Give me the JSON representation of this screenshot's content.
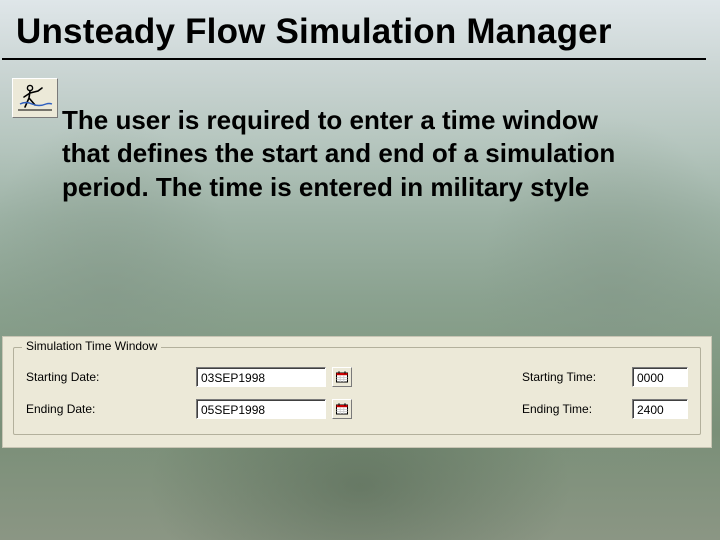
{
  "title": "Unsteady Flow Simulation Manager",
  "body_text": "The user is required to enter a time window that defines the start and end of a simulation period.  The time is entered in military style",
  "panel": {
    "legend": "Simulation Time Window",
    "starting_date_label": "Starting Date:",
    "starting_date_value": "03SEP1998",
    "ending_date_label": "Ending Date:",
    "ending_date_value": "05SEP1998",
    "starting_time_label": "Starting Time:",
    "starting_time_value": "0000",
    "ending_time_label": "Ending Time:",
    "ending_time_value": "2400"
  }
}
